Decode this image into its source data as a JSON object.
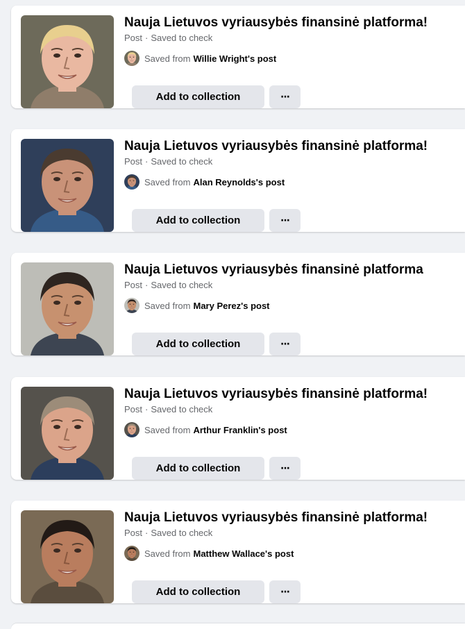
{
  "saved_items": [
    {
      "title": "Nauja Lietuvos vyriausybės finansinė platforma!",
      "type": "Post",
      "separator": "·",
      "saved_to_prefix": "Saved to",
      "collection": "check",
      "saved_from_prefix": "Saved from",
      "author": "Willie Wright's post",
      "add_label": "Add to collection",
      "more_label": "···",
      "colors": {
        "skin": "#e9b8a1",
        "hair": "#e8cf8e",
        "bg": "#6d6a5a",
        "shirt": "#8f7d6a"
      }
    },
    {
      "title": "Nauja Lietuvos vyriausybės finansinė platforma!",
      "type": "Post",
      "separator": "·",
      "saved_to_prefix": "Saved to",
      "collection": "check",
      "saved_from_prefix": "Saved from",
      "author": "Alan Reynolds's post",
      "add_label": "Add to collection",
      "more_label": "···",
      "colors": {
        "skin": "#c99278",
        "hair": "#4a3b30",
        "bg": "#2f3f5a",
        "shirt": "#365b87"
      }
    },
    {
      "title": "Nauja Lietuvos vyriausybės finansinė platforma",
      "type": "Post",
      "separator": "·",
      "saved_to_prefix": "Saved to",
      "collection": "check",
      "saved_from_prefix": "Saved from",
      "author": "Mary Perez's post",
      "add_label": "Add to collection",
      "more_label": "···",
      "colors": {
        "skin": "#c7916f",
        "hair": "#2e2520",
        "bg": "#bdbdb7",
        "shirt": "#3d4552"
      }
    },
    {
      "title": "Nauja Lietuvos vyriausybės finansinė platforma!",
      "type": "Post",
      "separator": "·",
      "saved_to_prefix": "Saved to",
      "collection": "check",
      "saved_from_prefix": "Saved from",
      "author": "Arthur Franklin's post",
      "add_label": "Add to collection",
      "more_label": "···",
      "colors": {
        "skin": "#dba48a",
        "hair": "#9c8c79",
        "bg": "#55524c",
        "shirt": "#2c3e5c"
      }
    },
    {
      "title": "Nauja Lietuvos vyriausybės finansinė platforma!",
      "type": "Post",
      "separator": "·",
      "saved_to_prefix": "Saved to",
      "collection": "check",
      "saved_from_prefix": "Saved from",
      "author": "Matthew Wallace's post",
      "add_label": "Add to collection",
      "more_label": "···",
      "colors": {
        "skin": "#b97d5e",
        "hair": "#221a16",
        "bg": "#7a6a55",
        "shirt": "#5a4d3e"
      }
    }
  ]
}
